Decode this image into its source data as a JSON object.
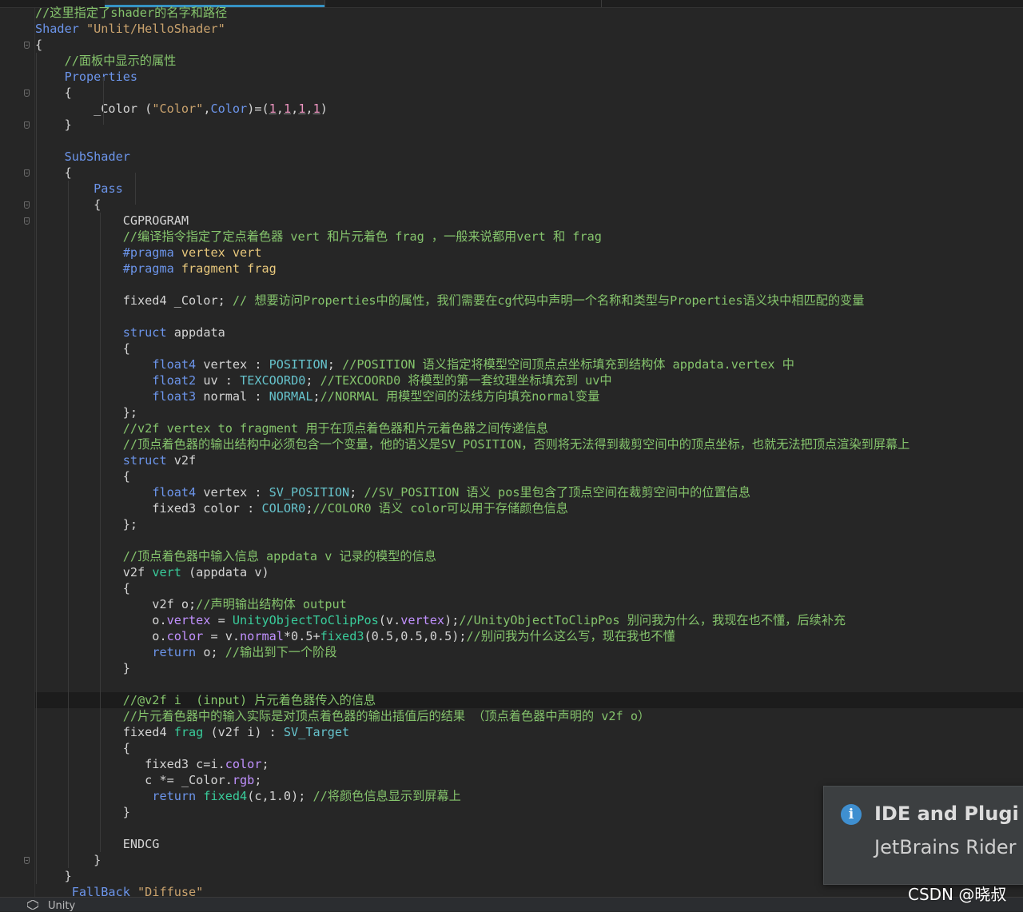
{
  "editor": {
    "lines": [
      {
        "tokens": [
          {
            "t": "//这里指定了shader的名字和路径",
            "c": "cm"
          }
        ]
      },
      {
        "tokens": [
          {
            "t": "Shader ",
            "c": "kw"
          },
          {
            "t": "\"Unlit/HelloShader\"",
            "c": "str"
          }
        ]
      },
      {
        "tokens": [
          {
            "t": "{",
            "c": "ident"
          }
        ]
      },
      {
        "tokens": [
          {
            "t": "    ",
            "c": "ident"
          },
          {
            "t": "//面板中显示的属性",
            "c": "cm"
          }
        ]
      },
      {
        "tokens": [
          {
            "t": "    ",
            "c": "ident"
          },
          {
            "t": "Properties",
            "c": "kw"
          }
        ]
      },
      {
        "tokens": [
          {
            "t": "    {",
            "c": "ident"
          }
        ]
      },
      {
        "tokens": [
          {
            "t": "        _Color (",
            "c": "ident"
          },
          {
            "t": "\"Color\"",
            "c": "str"
          },
          {
            "t": ",",
            "c": "ident"
          },
          {
            "t": "Color",
            "c": "kw"
          },
          {
            "t": ")=(",
            "c": "ident"
          },
          {
            "t": "1",
            "c": "num"
          },
          {
            "t": ",",
            "c": "numw"
          },
          {
            "t": "1",
            "c": "num"
          },
          {
            "t": ",",
            "c": "numw"
          },
          {
            "t": "1",
            "c": "num"
          },
          {
            "t": ",",
            "c": "numw"
          },
          {
            "t": "1",
            "c": "num"
          },
          {
            "t": ")",
            "c": "ident"
          }
        ]
      },
      {
        "tokens": [
          {
            "t": "    }",
            "c": "ident"
          }
        ]
      },
      {
        "tokens": [
          {
            "t": "",
            "c": "ident"
          }
        ]
      },
      {
        "tokens": [
          {
            "t": "    ",
            "c": "ident"
          },
          {
            "t": "SubShader",
            "c": "kw"
          }
        ]
      },
      {
        "tokens": [
          {
            "t": "    {",
            "c": "ident"
          }
        ]
      },
      {
        "tokens": [
          {
            "t": "        ",
            "c": "ident"
          },
          {
            "t": "Pass",
            "c": "kw"
          }
        ]
      },
      {
        "tokens": [
          {
            "t": "        {",
            "c": "ident"
          }
        ]
      },
      {
        "tokens": [
          {
            "t": "            CGPROGRAM",
            "c": "ident"
          }
        ]
      },
      {
        "tokens": [
          {
            "t": "            ",
            "c": "ident"
          },
          {
            "t": "//编译指令指定了定点着色器 vert 和片元着色 frag ，一般来说都用vert 和 frag",
            "c": "cm"
          }
        ]
      },
      {
        "tokens": [
          {
            "t": "            ",
            "c": "ident"
          },
          {
            "t": "#pragma ",
            "c": "ppd"
          },
          {
            "t": "vertex vert",
            "c": "prag"
          }
        ]
      },
      {
        "tokens": [
          {
            "t": "            ",
            "c": "ident"
          },
          {
            "t": "#pragma ",
            "c": "ppd"
          },
          {
            "t": "fragment frag",
            "c": "prag"
          }
        ]
      },
      {
        "tokens": [
          {
            "t": "",
            "c": "ident"
          }
        ]
      },
      {
        "tokens": [
          {
            "t": "            fixed4 _Color; ",
            "c": "ident"
          },
          {
            "t": "// 想要访问Properties中的属性，我们需要在cg代码中声明一个名称和类型与Properties语义块中相匹配的变量",
            "c": "cm"
          }
        ]
      },
      {
        "tokens": [
          {
            "t": "",
            "c": "ident"
          }
        ]
      },
      {
        "tokens": [
          {
            "t": "            ",
            "c": "ident"
          },
          {
            "t": "struct ",
            "c": "kw"
          },
          {
            "t": "appdata",
            "c": "ident"
          }
        ]
      },
      {
        "tokens": [
          {
            "t": "            {",
            "c": "ident"
          }
        ]
      },
      {
        "tokens": [
          {
            "t": "                ",
            "c": "ident"
          },
          {
            "t": "float4",
            "c": "ty"
          },
          {
            "t": " vertex : ",
            "c": "ident"
          },
          {
            "t": "POSITION",
            "c": "sem"
          },
          {
            "t": "; ",
            "c": "ident"
          },
          {
            "t": "//POSITION 语义指定将模型空间顶点点坐标填充到结构体 appdata.vertex 中",
            "c": "cm"
          }
        ]
      },
      {
        "tokens": [
          {
            "t": "                ",
            "c": "ident"
          },
          {
            "t": "float2",
            "c": "ty"
          },
          {
            "t": " uv : ",
            "c": "ident"
          },
          {
            "t": "TEXCOORD0",
            "c": "sem"
          },
          {
            "t": "; ",
            "c": "ident"
          },
          {
            "t": "//TEXCOORD0 将模型的第一套纹理坐标填充到 uv中",
            "c": "cm"
          }
        ]
      },
      {
        "tokens": [
          {
            "t": "                ",
            "c": "ident"
          },
          {
            "t": "float3",
            "c": "ty"
          },
          {
            "t": " normal : ",
            "c": "ident"
          },
          {
            "t": "NORMAL",
            "c": "sem"
          },
          {
            "t": ";",
            "c": "ident"
          },
          {
            "t": "//NORMAL 用模型空间的法线方向填充normal变量",
            "c": "cm"
          }
        ]
      },
      {
        "tokens": [
          {
            "t": "            };",
            "c": "ident"
          }
        ]
      },
      {
        "tokens": [
          {
            "t": "            ",
            "c": "ident"
          },
          {
            "t": "//v2f vertex to fragment 用于在顶点着色器和片元着色器之间传递信息",
            "c": "cm"
          }
        ]
      },
      {
        "tokens": [
          {
            "t": "            ",
            "c": "ident"
          },
          {
            "t": "//顶点着色器的输出结构中必须包含一个变量，他的语义是SV_POSITION，否则将无法得到裁剪空间中的顶点坐标，也就无法把顶点渲染到屏幕上",
            "c": "cm"
          }
        ]
      },
      {
        "tokens": [
          {
            "t": "            ",
            "c": "ident"
          },
          {
            "t": "struct ",
            "c": "kw"
          },
          {
            "t": "v2f",
            "c": "ident"
          }
        ]
      },
      {
        "tokens": [
          {
            "t": "            {",
            "c": "ident"
          }
        ]
      },
      {
        "tokens": [
          {
            "t": "                ",
            "c": "ident"
          },
          {
            "t": "float4",
            "c": "ty"
          },
          {
            "t": " vertex : ",
            "c": "ident"
          },
          {
            "t": "SV_POSITION",
            "c": "sem"
          },
          {
            "t": "; ",
            "c": "ident"
          },
          {
            "t": "//SV_POSITION 语义 pos里包含了顶点空间在裁剪空间中的位置信息",
            "c": "cm"
          }
        ]
      },
      {
        "tokens": [
          {
            "t": "                fixed3 color : ",
            "c": "ident"
          },
          {
            "t": "COLOR0",
            "c": "sem"
          },
          {
            "t": ";",
            "c": "ident"
          },
          {
            "t": "//COLOR0 语义 color可以用于存储颜色信息",
            "c": "cm"
          }
        ]
      },
      {
        "tokens": [
          {
            "t": "            };",
            "c": "ident"
          }
        ]
      },
      {
        "tokens": [
          {
            "t": "",
            "c": "ident"
          }
        ]
      },
      {
        "tokens": [
          {
            "t": "            ",
            "c": "ident"
          },
          {
            "t": "//顶点着色器中输入信息 appdata v 记录的模型的信息",
            "c": "cm"
          }
        ]
      },
      {
        "tokens": [
          {
            "t": "            v2f ",
            "c": "ident"
          },
          {
            "t": "vert",
            "c": "fn"
          },
          {
            "t": " (appdata v)",
            "c": "ident"
          }
        ]
      },
      {
        "tokens": [
          {
            "t": "            {",
            "c": "ident"
          }
        ]
      },
      {
        "tokens": [
          {
            "t": "                v2f o;",
            "c": "ident"
          },
          {
            "t": "//声明输出结构体 output",
            "c": "cm"
          }
        ]
      },
      {
        "tokens": [
          {
            "t": "                o.",
            "c": "ident"
          },
          {
            "t": "vertex",
            "c": "mg"
          },
          {
            "t": " = ",
            "c": "ident"
          },
          {
            "t": "UnityObjectToClipPos",
            "c": "fn"
          },
          {
            "t": "(v.",
            "c": "ident"
          },
          {
            "t": "vertex",
            "c": "mg"
          },
          {
            "t": ");",
            "c": "ident"
          },
          {
            "t": "//UnityObjectToClipPos 别问我为什么，我现在也不懂，后续补充",
            "c": "cm"
          }
        ]
      },
      {
        "tokens": [
          {
            "t": "                o.",
            "c": "ident"
          },
          {
            "t": "color",
            "c": "mg"
          },
          {
            "t": " = v.",
            "c": "ident"
          },
          {
            "t": "normal",
            "c": "mg"
          },
          {
            "t": "*0.5+",
            "c": "ident"
          },
          {
            "t": "fixed3",
            "c": "fn"
          },
          {
            "t": "(0.5,0.5,0.5);",
            "c": "ident"
          },
          {
            "t": "//别问我为什么这么写，现在我也不懂",
            "c": "cm"
          }
        ]
      },
      {
        "tokens": [
          {
            "t": "                ",
            "c": "ident"
          },
          {
            "t": "return",
            "c": "kw"
          },
          {
            "t": " o; ",
            "c": "ident"
          },
          {
            "t": "//输出到下一个阶段",
            "c": "cm"
          }
        ]
      },
      {
        "tokens": [
          {
            "t": "            }",
            "c": "ident"
          }
        ]
      },
      {
        "tokens": [
          {
            "t": "",
            "c": "ident"
          }
        ]
      },
      {
        "tokens": [
          {
            "t": "            ",
            "c": "ident"
          },
          {
            "t": "//@v2f i  (input) 片元着色器传入的信息",
            "c": "cm"
          }
        ],
        "current": true
      },
      {
        "tokens": [
          {
            "t": "            ",
            "c": "ident"
          },
          {
            "t": "//片元着色器中的输入实际是对顶点着色器的输出插值后的结果 （顶点着色器中声明的 v2f o）",
            "c": "cm"
          }
        ]
      },
      {
        "tokens": [
          {
            "t": "            fixed4 ",
            "c": "ident"
          },
          {
            "t": "frag",
            "c": "fn"
          },
          {
            "t": " (v2f i) : ",
            "c": "ident"
          },
          {
            "t": "SV_Target",
            "c": "sem"
          }
        ]
      },
      {
        "tokens": [
          {
            "t": "            {",
            "c": "ident"
          }
        ]
      },
      {
        "tokens": [
          {
            "t": "               fixed3 c=i.",
            "c": "ident"
          },
          {
            "t": "color",
            "c": "mg"
          },
          {
            "t": ";",
            "c": "ident"
          }
        ]
      },
      {
        "tokens": [
          {
            "t": "               c *= _Color.",
            "c": "ident"
          },
          {
            "t": "rgb",
            "c": "mg"
          },
          {
            "t": ";",
            "c": "ident"
          }
        ]
      },
      {
        "tokens": [
          {
            "t": "                ",
            "c": "ident"
          },
          {
            "t": "return ",
            "c": "kw"
          },
          {
            "t": "fixed4",
            "c": "fn"
          },
          {
            "t": "(c,1.0); ",
            "c": "ident"
          },
          {
            "t": "//将颜色信息显示到屏幕上",
            "c": "cm"
          }
        ]
      },
      {
        "tokens": [
          {
            "t": "            }",
            "c": "ident"
          }
        ]
      },
      {
        "tokens": [
          {
            "t": "",
            "c": "ident"
          }
        ]
      },
      {
        "tokens": [
          {
            "t": "            ENDCG",
            "c": "ident"
          }
        ]
      },
      {
        "tokens": [
          {
            "t": "        }",
            "c": "ident"
          }
        ]
      },
      {
        "tokens": [
          {
            "t": "    }",
            "c": "ident"
          }
        ]
      },
      {
        "tokens": [
          {
            "t": "     ",
            "c": "ident"
          },
          {
            "t": "FallBack ",
            "c": "kw"
          },
          {
            "t": "\"Diffuse\"",
            "c": "str"
          }
        ]
      }
    ]
  },
  "notification": {
    "icon": "info-icon",
    "title": "IDE and Plugi",
    "body": "JetBrains Rider"
  },
  "statusbar": {
    "icon": "unity-icon",
    "label": "Unity"
  },
  "watermark": "CSDN @晓叔",
  "colors": {
    "background": "#262626",
    "keyword": "#6c95eb",
    "string": "#c9a26d",
    "comment": "#85c46c",
    "function": "#39cc9b",
    "member": "#c191ff",
    "semantic": "#66c3cc",
    "accent": "#3592c4"
  }
}
